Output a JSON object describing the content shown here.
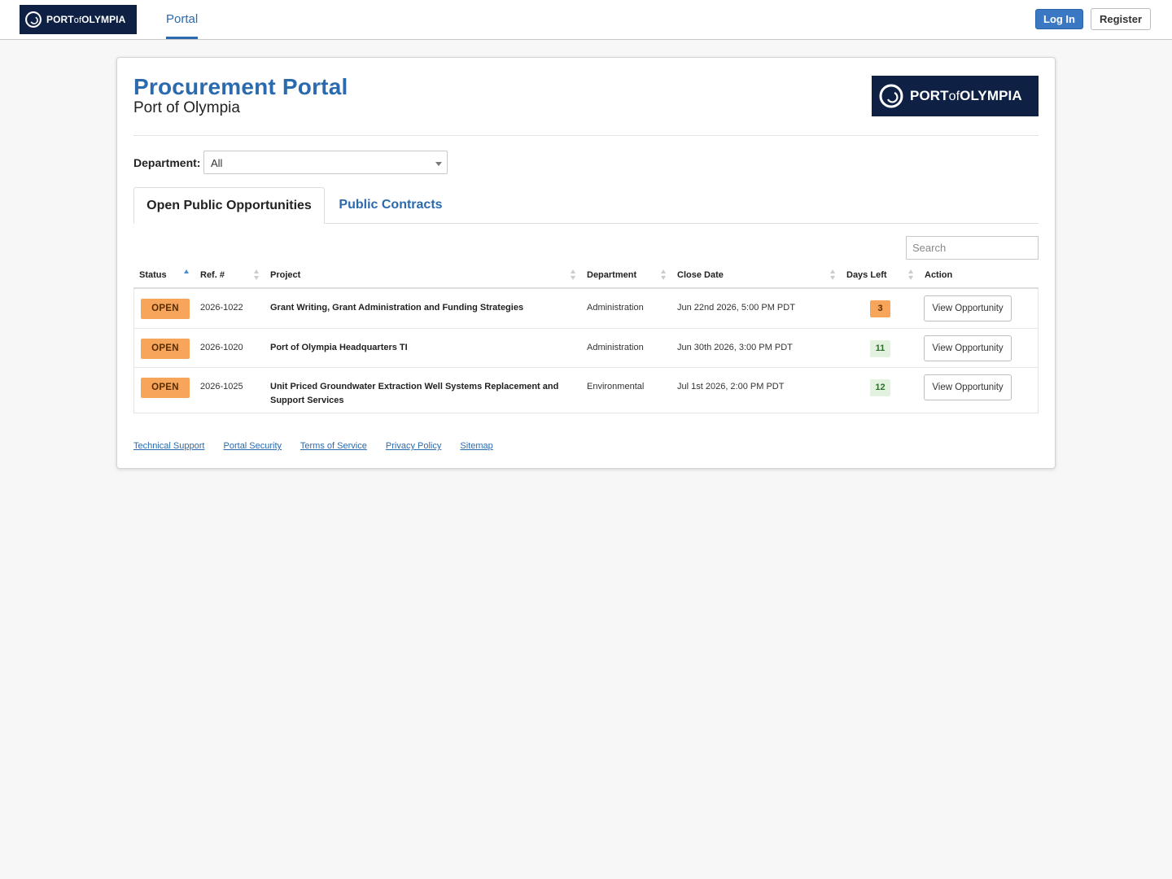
{
  "nav": {
    "brand": {
      "port": "PORT",
      "of": "of",
      "olympia": "OLYMPIA"
    },
    "portal_link": "Portal",
    "login": "Log In",
    "register": "Register"
  },
  "header": {
    "title": "Procurement Portal",
    "subtitle": "Port of Olympia"
  },
  "filter": {
    "label": "Department:",
    "selected": "All"
  },
  "tabs": [
    {
      "label": "Open Public Opportunities",
      "active": true
    },
    {
      "label": "Public Contracts",
      "active": false
    }
  ],
  "search": {
    "placeholder": "Search"
  },
  "table": {
    "columns": [
      "Status",
      "Ref. #",
      "Project",
      "Department",
      "Close Date",
      "Days Left",
      "Action"
    ],
    "rows": [
      {
        "status": "OPEN",
        "ref": "2026-1022",
        "project": "Grant Writing, Grant Administration and Funding Strategies",
        "department": "Administration",
        "close": "Jun 22nd 2026, 5:00 PM PDT",
        "days": "3",
        "action": "View Opportunity"
      },
      {
        "status": "OPEN",
        "ref": "2026-1020",
        "project": "Port of Olympia Headquarters TI",
        "department": "Administration",
        "close": "Jun 30th 2026, 3:00 PM PDT",
        "days": "11",
        "action": "View Opportunity"
      },
      {
        "status": "OPEN",
        "ref": "2026-1025",
        "project": "Unit Priced Groundwater Extraction Well Systems Replacement and Support Services",
        "department": "Environmental",
        "close": "Jul 1st 2026, 2:00 PM PDT",
        "days": "12",
        "action": "View Opportunity"
      }
    ]
  },
  "footer": {
    "links": [
      "Technical Support",
      "Portal Security",
      "Terms of Service",
      "Privacy Policy",
      "Sitemap"
    ]
  },
  "colors": {
    "brand_navy": "#0e2145",
    "link_blue": "#2a6aad",
    "status_open": "#f7a55a",
    "days_ok": "#e2f2df"
  }
}
